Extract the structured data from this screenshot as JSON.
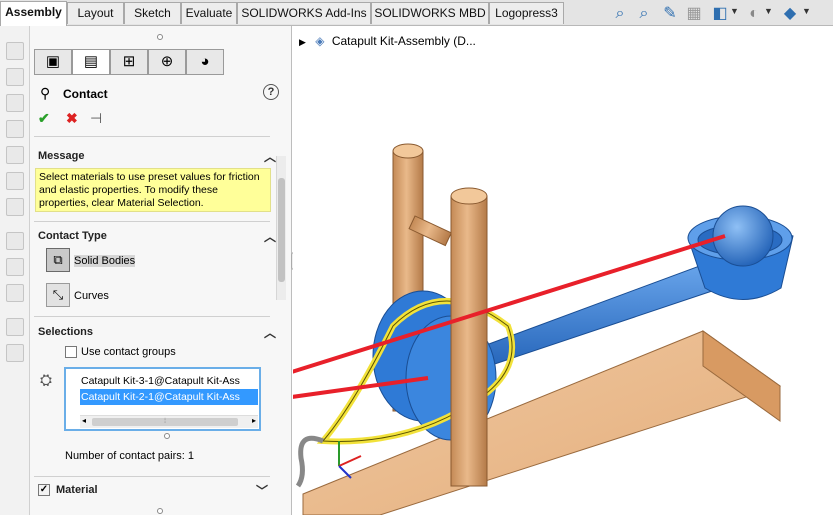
{
  "tabs": [
    "Assembly",
    "Layout",
    "Sketch",
    "Evaluate",
    "SOLIDWORKS Add-Ins",
    "SOLIDWORKS MBD",
    "Logopress3"
  ],
  "active_tab": "Assembly",
  "right_toolbar_icons": [
    "zoom-to-fit-icon",
    "zoom-area-icon",
    "section-view-icon",
    "view-settings-icon",
    "display-style-icon",
    "hide-show-icon",
    "view-orientation-icon"
  ],
  "property_manager": {
    "tab_icons": [
      "feature-manager-icon",
      "property-manager-icon",
      "configuration-manager-icon",
      "dimxpert-icon",
      "display-manager-icon"
    ],
    "title": "Contact",
    "help": "?",
    "actions": {
      "ok": "✔",
      "cancel": "✖",
      "pin": "⊣"
    },
    "message": {
      "header": "Message",
      "text": "Select materials to use preset values for friction and elastic properties. To modify these properties, clear Material Selection."
    },
    "contact_type": {
      "header": "Contact Type",
      "options": [
        {
          "label": "Solid Bodies",
          "selected": true
        },
        {
          "label": "Curves",
          "selected": false
        }
      ]
    },
    "selections": {
      "header": "Selections",
      "use_groups_label": "Use contact groups",
      "use_groups_checked": false,
      "items": [
        {
          "label": "Catapult Kit-3-1@Catapult Kit-Ass",
          "selected": false
        },
        {
          "label": "Catapult Kit-2-1@Catapult Kit-Ass",
          "selected": true
        }
      ],
      "pairs_text": "Number of contact pairs: 1"
    },
    "material": {
      "header": "Material",
      "checked": true
    }
  },
  "graphics": {
    "tree_label": "Catapult Kit-Assembly  (D..."
  },
  "colors": {
    "wood": "#e8b58a",
    "wood_dark": "#b07a4a",
    "blue": "#2f7ad6",
    "contact_line": "#e8202a",
    "highlight": "#f2e23a"
  }
}
